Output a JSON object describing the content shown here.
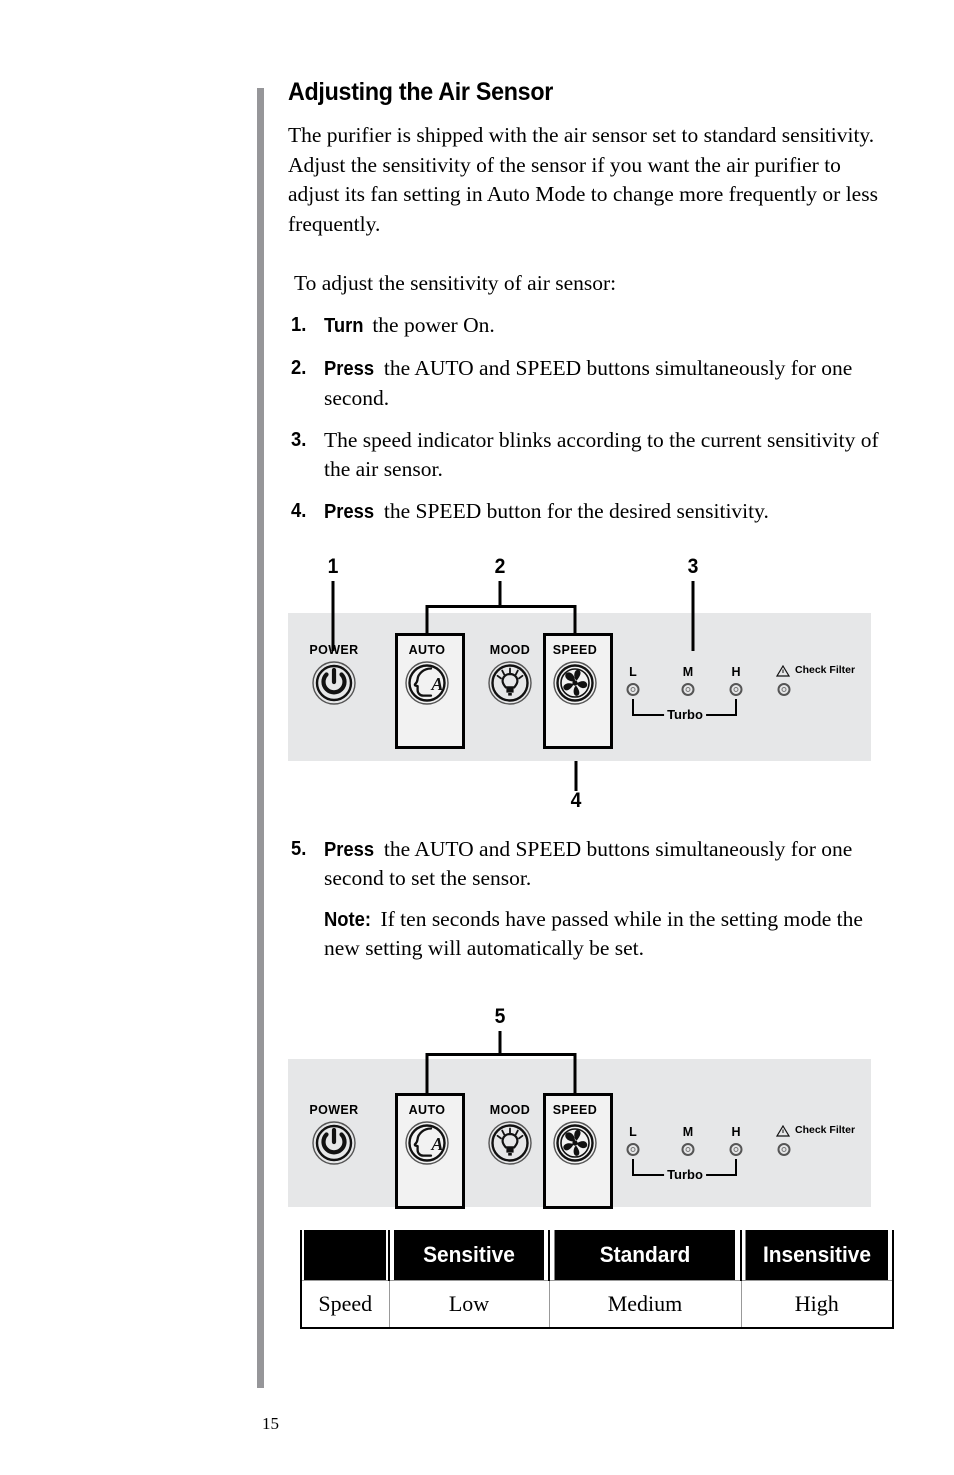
{
  "page": {
    "number": "15",
    "accent_bar_color": "#969699",
    "panel_background": "#e6e7e8"
  },
  "section": {
    "title": "Adjusting the Air Sensor",
    "intro": "The purifier is shipped with the air sensor set to standard sensitivity. Adjust the sensitivity of the sensor if you want the air purifier to adjust its fan setting in Auto Mode to change more frequently or less frequently.",
    "lead_in": "To adjust the sensitivity of air sensor:"
  },
  "steps": [
    {
      "num": "1.",
      "keyword": "Turn",
      "text": " the power On."
    },
    {
      "num": "2.",
      "keyword": "Press",
      "text": " the AUTO and SPEED buttons simultaneously for one second."
    },
    {
      "num": "3.",
      "keyword": "",
      "text": "The speed indicator blinks according to the current sensitivity of the air sensor."
    },
    {
      "num": "4.",
      "keyword": "Press",
      "text": " the SPEED button for the desired sensitivity."
    },
    {
      "num": "5.",
      "keyword": "Press",
      "text": " the AUTO and SPEED buttons simultaneously for one second to set the sensor."
    }
  ],
  "note": {
    "keyword": "Note:",
    "text": " If ten seconds have passed while in the setting mode the new setting will automatically be set."
  },
  "figure_one": {
    "callouts": [
      "1",
      "2",
      "3",
      "4"
    ],
    "buttons": [
      {
        "label": "POWER",
        "icon": "power-icon",
        "highlighted": false
      },
      {
        "label": "AUTO",
        "icon": "auto-head-icon",
        "highlighted": true
      },
      {
        "label": "MOOD",
        "icon": "mood-bulb-icon",
        "highlighted": false
      },
      {
        "label": "SPEED",
        "icon": "speed-fan-icon",
        "highlighted": true
      }
    ],
    "indicators": [
      "L",
      "M",
      "H"
    ],
    "turbo_label": "Turbo",
    "check_filter_label": "Check Filter"
  },
  "figure_two": {
    "callouts": [
      "5"
    ],
    "buttons": [
      {
        "label": "POWER",
        "icon": "power-icon",
        "highlighted": false
      },
      {
        "label": "AUTO",
        "icon": "auto-head-icon",
        "highlighted": true
      },
      {
        "label": "MOOD",
        "icon": "mood-bulb-icon",
        "highlighted": false
      },
      {
        "label": "SPEED",
        "icon": "speed-fan-icon",
        "highlighted": true
      }
    ],
    "indicators": [
      "L",
      "M",
      "H"
    ],
    "turbo_label": "Turbo",
    "check_filter_label": "Check Filter"
  },
  "table": {
    "headers": [
      "",
      "Sensitive",
      "Standard",
      "Insensitive"
    ],
    "rows": [
      [
        "Speed",
        "Low",
        "Medium",
        "High"
      ]
    ]
  }
}
